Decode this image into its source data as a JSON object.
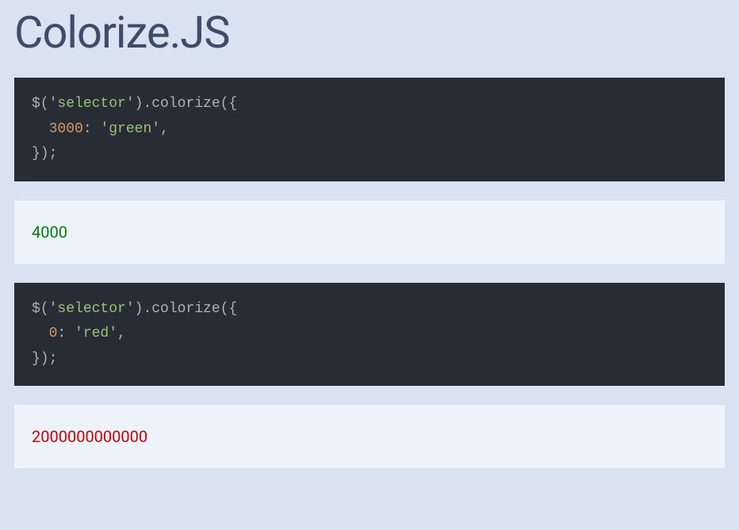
{
  "title": "Colorize.JS",
  "examples": [
    {
      "code": {
        "line1_prefix": "$(",
        "line1_selector": "'selector'",
        "line1_mid": ").",
        "line1_fn": "colorize",
        "line1_open": "({",
        "line2_indent": "  ",
        "line2_key": "3000",
        "line2_colon": ": ",
        "line2_val": "'green'",
        "line2_comma": ",",
        "line3": "});"
      },
      "output": "4000",
      "output_color": "green"
    },
    {
      "code": {
        "line1_prefix": "$(",
        "line1_selector": "'selector'",
        "line1_mid": ").",
        "line1_fn": "colorize",
        "line1_open": "({",
        "line2_indent": "  ",
        "line2_key": "0",
        "line2_colon": ": ",
        "line2_val": "'red'",
        "line2_comma": ",",
        "line3": "});"
      },
      "output": "2000000000000",
      "output_color": "red"
    }
  ]
}
